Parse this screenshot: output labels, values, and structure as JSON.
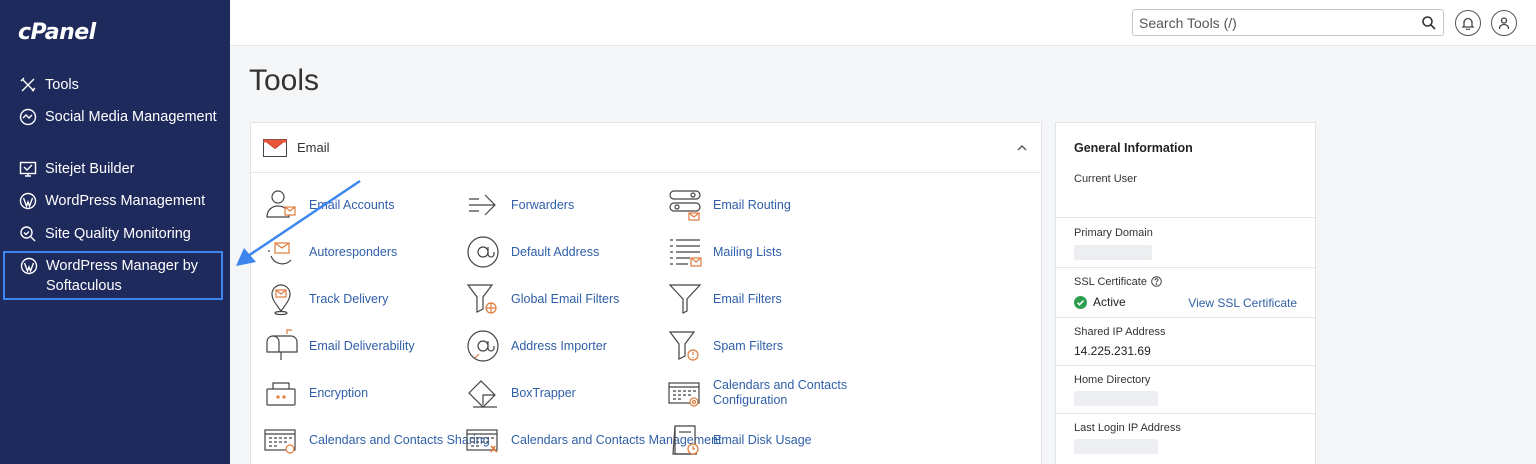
{
  "app": {
    "logo": "cPanel"
  },
  "sidebar": {
    "items": [
      {
        "label": "Tools",
        "icon": "tools-icon"
      },
      {
        "label": "Social Media Management",
        "icon": "social-media-icon"
      },
      {
        "label": "Sitejet Builder",
        "icon": "sitejet-icon"
      },
      {
        "label": "WordPress Management",
        "icon": "wordpress-icon"
      },
      {
        "label": "Site Quality Monitoring",
        "icon": "site-quality-icon"
      },
      {
        "label": "WordPress Manager by Softaculous",
        "icon": "wordpress-icon"
      }
    ]
  },
  "header": {
    "search_placeholder": "Search Tools (/)"
  },
  "page": {
    "title": "Tools"
  },
  "email_panel": {
    "title": "Email",
    "tools": [
      {
        "label": "Email Accounts",
        "icon": "email-accounts-icon"
      },
      {
        "label": "Forwarders",
        "icon": "forwarders-icon"
      },
      {
        "label": "Email Routing",
        "icon": "email-routing-icon"
      },
      {
        "label": "Autoresponders",
        "icon": "autoresponders-icon"
      },
      {
        "label": "Default Address",
        "icon": "default-address-icon"
      },
      {
        "label": "Mailing Lists",
        "icon": "mailing-lists-icon"
      },
      {
        "label": "Track Delivery",
        "icon": "track-delivery-icon"
      },
      {
        "label": "Global Email Filters",
        "icon": "global-email-filters-icon"
      },
      {
        "label": "Email Filters",
        "icon": "email-filters-icon"
      },
      {
        "label": "Email Deliverability",
        "icon": "email-deliverability-icon"
      },
      {
        "label": "Address Importer",
        "icon": "address-importer-icon"
      },
      {
        "label": "Spam Filters",
        "icon": "spam-filters-icon"
      },
      {
        "label": "Encryption",
        "icon": "encryption-icon"
      },
      {
        "label": "BoxTrapper",
        "icon": "boxtrapper-icon"
      },
      {
        "label": "Calendars and Contacts Configuration",
        "icon": "calendar-config-icon"
      },
      {
        "label": "Calendars and Contacts Sharing",
        "icon": "calendar-sharing-icon"
      },
      {
        "label": "Calendars and Contacts Management",
        "icon": "calendar-management-icon"
      },
      {
        "label": "Email Disk Usage",
        "icon": "email-disk-usage-icon"
      }
    ]
  },
  "general_info": {
    "title": "General Information",
    "current_user_label": "Current User",
    "primary_domain_label": "Primary Domain",
    "ssl_label": "SSL Certificate",
    "ssl_status": "Active",
    "ssl_link": "View SSL Certificate",
    "shared_ip_label": "Shared IP Address",
    "shared_ip_value": "14.225.231.69",
    "home_dir_label": "Home Directory",
    "last_login_label": "Last Login IP Address"
  },
  "colors": {
    "sidebar_bg": "#1f2a5c",
    "link": "#2f5fa8",
    "accent_orange": "#e07b3c",
    "highlight": "#3d86f0",
    "success": "#2e9e4f"
  }
}
